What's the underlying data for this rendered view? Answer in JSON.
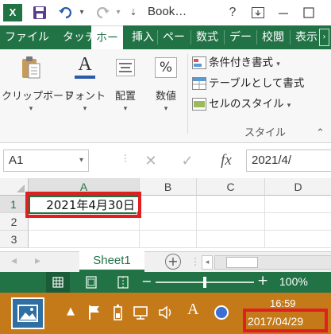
{
  "titlebar": {
    "app_icon": "X",
    "document_title": "Book…",
    "help_label": "?",
    "colors": {
      "accent": "#217346"
    }
  },
  "tabs": [
    {
      "label": "ファイル",
      "active": false
    },
    {
      "label": "タッチ",
      "active": false
    },
    {
      "label": "ホー",
      "active": true
    },
    {
      "label": "挿入",
      "active": false
    },
    {
      "label": "ペー",
      "active": false
    },
    {
      "label": "数式",
      "active": false
    },
    {
      "label": "デー",
      "active": false
    },
    {
      "label": "校閲",
      "active": false
    },
    {
      "label": "表示",
      "active": false
    }
  ],
  "ribbon": {
    "clipboard_label": "クリップボード",
    "font_label": "フォント",
    "alignment_label": "配置",
    "number_label": "数値",
    "percent_symbol": "%",
    "font_glyph": "A",
    "conditional_format": "条件付き書式",
    "format_as_table": "テーブルとして書式",
    "cell_styles": "セルのスタイル",
    "styles_group_label": "スタイル"
  },
  "formula_bar": {
    "name_box": "A1",
    "fx_label": "fx",
    "formula_value": "2021/4/"
  },
  "grid": {
    "columns": [
      "A",
      "B",
      "C",
      "D"
    ],
    "rows": [
      "1",
      "2",
      "3"
    ],
    "a1_value": "2021年4月30日"
  },
  "sheets": {
    "active_sheet": "Sheet1",
    "add_label": "+"
  },
  "statusbar": {
    "zoom": "100%",
    "zoom_minus": "−",
    "zoom_plus": "+",
    "zoom_fraction": 0.5
  },
  "taskbar": {
    "time": "16:59",
    "date": "2017/04/29",
    "ime_glyph": "A",
    "highlight_color": "#e02020"
  }
}
